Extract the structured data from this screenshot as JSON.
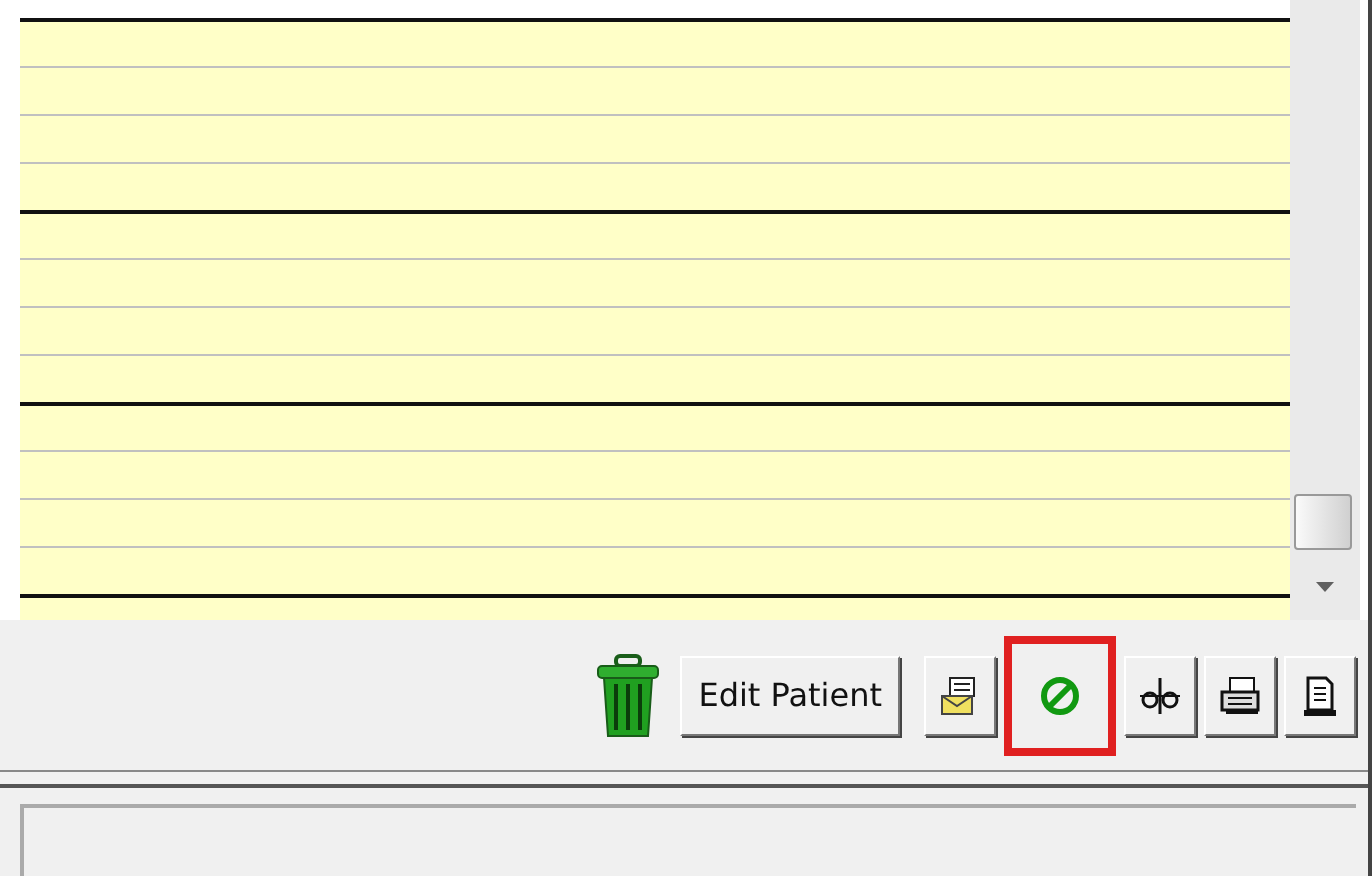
{
  "notes": {
    "kind": "lined"
  },
  "toolbar": {
    "buttons": [
      {
        "kind": "trash",
        "highlighted": false
      },
      {
        "kind": "text",
        "label": "Edit Patient",
        "highlighted": false
      },
      {
        "kind": "envelope",
        "highlighted": false
      },
      {
        "kind": "cancel",
        "highlighted": true
      },
      {
        "kind": "split",
        "highlighted": false
      },
      {
        "kind": "printer",
        "highlighted": false
      },
      {
        "kind": "document",
        "highlighted": false
      }
    ]
  }
}
